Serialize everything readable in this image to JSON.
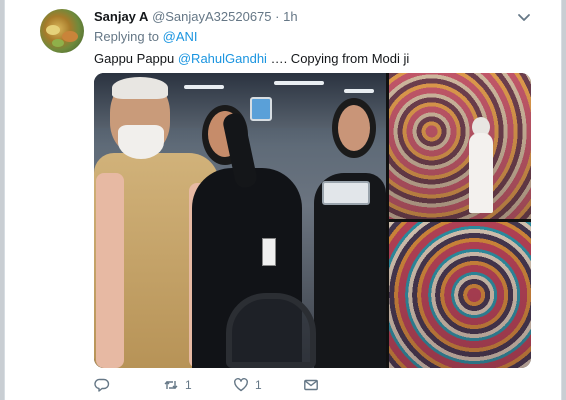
{
  "tweet": {
    "author_name": "Sanjay A",
    "author_handle": "@SanjayA32520675",
    "separator": "·",
    "time": "1h",
    "replying_prefix": "Replying to",
    "replying_to": "@ANI",
    "text_before": "Gappu Pappu",
    "mention": "@RahulGandhi",
    "text_after": "…. Copying from Modi ji",
    "media_count": 3
  },
  "actions": {
    "reply_icon": "reply-icon",
    "retweet_icon": "retweet-icon",
    "retweet_count": "1",
    "like_icon": "heart-icon",
    "like_count": "1",
    "dm_icon": "envelope-icon"
  },
  "colors": {
    "link": "#1b95e0",
    "text": "#14171a",
    "muted": "#657786"
  }
}
